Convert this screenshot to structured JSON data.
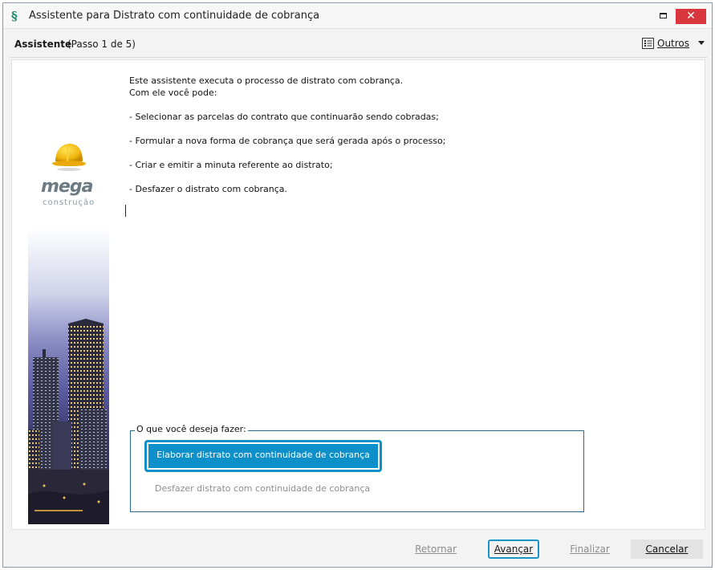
{
  "window": {
    "title": "Assistente para Distrato com continuidade de cobrança",
    "close_glyph": "✕"
  },
  "stepbar": {
    "label": "Assistente",
    "step": "(Passo 1 de 5)",
    "outros_label": "Outros"
  },
  "sidebar": {
    "logo_text": "mega",
    "logo_subtext": "construção"
  },
  "intro": {
    "line1": "Este assistente executa o processo de distrato com cobrança.",
    "line2": "Com ele você pode:",
    "items": [
      "- Selecionar as parcelas do contrato que continuarão sendo cobradas;",
      "- Formular a nova forma de cobrança que será gerada após o processo;",
      "- Criar e emitir a minuta referente ao distrato;",
      "- Desfazer o distrato com cobrança."
    ]
  },
  "options": {
    "legend": "O que você deseja fazer:",
    "primary": "Elaborar distrato com continuidade de cobrança",
    "secondary": "Desfazer distrato com continuidade de cobrança"
  },
  "footer": {
    "retornar": "Retornar",
    "avancar": "Avançar",
    "finalizar": "Finalizar",
    "cancelar": "Cancelar"
  },
  "colors": {
    "accent": "#0d8fc9",
    "close_button": "#d9363e",
    "window_bg": "#f3f3f3"
  },
  "icons": {
    "app": "mega-s-icon",
    "menu": "list-icon",
    "dropdown": "caret-down-icon",
    "helmet": "hard-hat-icon"
  }
}
